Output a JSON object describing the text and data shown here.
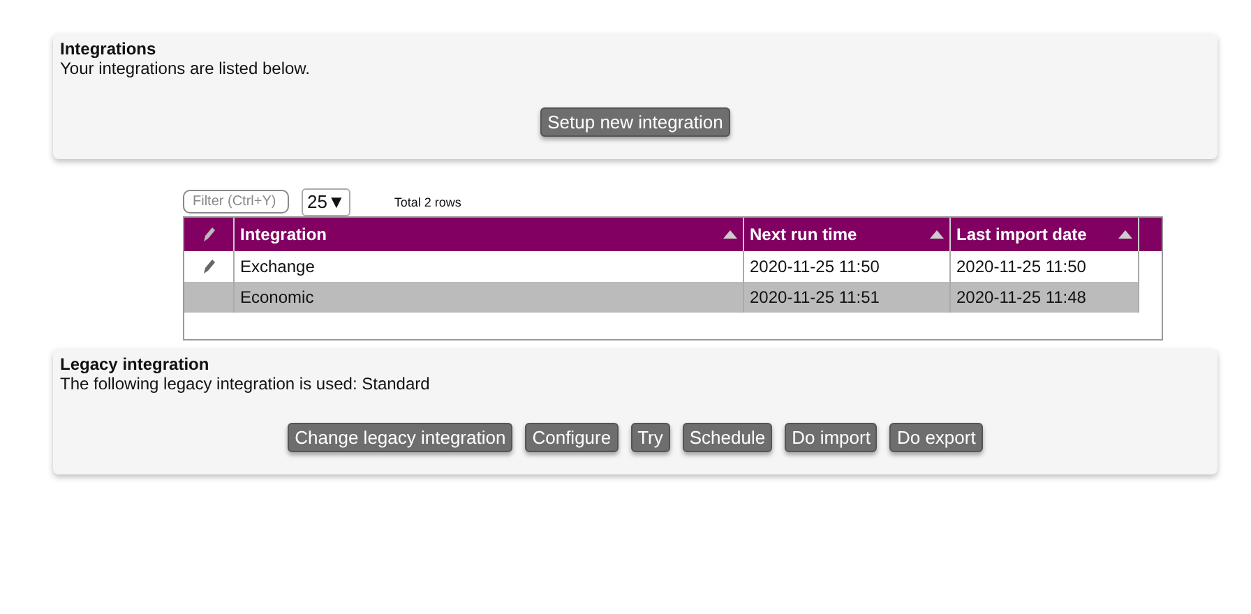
{
  "integrations_panel": {
    "title": "Integrations",
    "description": "Your integrations are listed below.",
    "button": "Setup new integration"
  },
  "table_controls": {
    "filter_placeholder": "Filter (Ctrl+Y)",
    "page_size": "25▼",
    "total": "Total 2 rows"
  },
  "table": {
    "columns": [
      "Integration",
      "Next run time",
      "Last import date"
    ],
    "rows": [
      {
        "cells": [
          "Exchange",
          "2020-11-25 11:50",
          "2020-11-25 11:50"
        ],
        "selected": false,
        "edit_icon": true
      },
      {
        "cells": [
          "Economic",
          "2020-11-25 11:51",
          "2020-11-25 11:48"
        ],
        "selected": true,
        "edit_icon": false
      }
    ]
  },
  "legacy_panel": {
    "title": "Legacy integration",
    "description": "The following legacy integration is used: Standard",
    "buttons": [
      "Change legacy integration",
      "Configure",
      "Try",
      "Schedule",
      "Do import",
      "Do export"
    ]
  }
}
